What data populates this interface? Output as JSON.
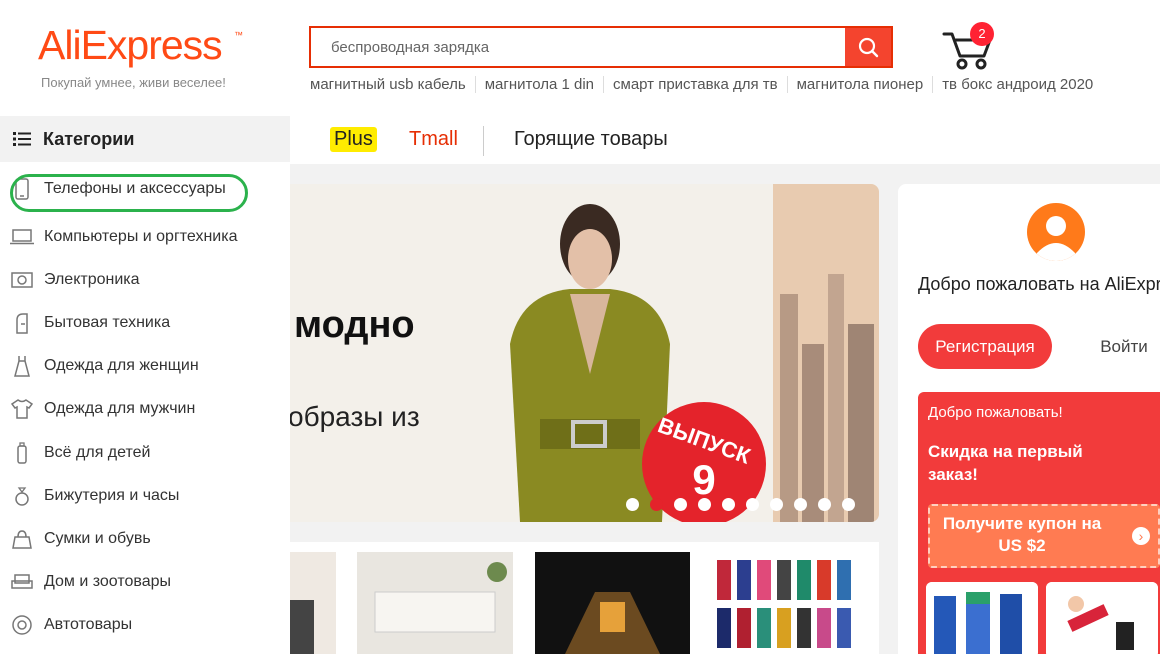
{
  "header": {
    "logo": "AliExpress",
    "logo_tm": "™",
    "slogan": "Покупай умнее, живи веселее!",
    "search": {
      "value": "беспроводная зарядка"
    },
    "hints": [
      "магнитный usb кабель",
      "магнитола 1 din",
      "смарт приставка для тв",
      "магнитола пионер",
      "тв бокс андроид 2020"
    ],
    "cart_count": "2"
  },
  "sidebar": {
    "title": "Категории",
    "items": [
      {
        "label": "Телефоны и аксессуары",
        "icon": "phone-icon"
      },
      {
        "label": "Компьютеры и оргтехника",
        "icon": "laptop-icon"
      },
      {
        "label": "Электроника",
        "icon": "camera-icon"
      },
      {
        "label": "Бытовая техника",
        "icon": "appliance-icon"
      },
      {
        "label": "Одежда для женщин",
        "icon": "dress-icon"
      },
      {
        "label": "Одежда для мужчин",
        "icon": "shirt-icon"
      },
      {
        "label": "Всё для детей",
        "icon": "bottle-icon"
      },
      {
        "label": "Бижутерия и часы",
        "icon": "ring-icon"
      },
      {
        "label": "Сумки и обувь",
        "icon": "bag-icon"
      },
      {
        "label": "Дом и зоотовары",
        "icon": "sofa-icon"
      },
      {
        "label": "Автотовары",
        "icon": "wheel-icon"
      }
    ]
  },
  "nav": {
    "plus": "Plus",
    "tmall": "Tmall",
    "hot": "Горящие товары"
  },
  "banner": {
    "text1": "модно",
    "text2": "образы из",
    "issue_label": "ВЫПУСК",
    "issue_number": "9",
    "slide_count": 10,
    "active_slide": 2
  },
  "welcome": {
    "title": "Добро пожаловать на AliExpress",
    "register": "Регистрация",
    "login": "Войти",
    "promo": {
      "hello": "Добро пожаловать!",
      "discount": "Скидка на первый заказ!",
      "coupon": "Получите купон на US $2"
    }
  },
  "colors": {
    "brand": "#ff4a15",
    "accent": "#f23b3b",
    "tmall": "#e62e04",
    "highlight": "#2bb24c"
  }
}
